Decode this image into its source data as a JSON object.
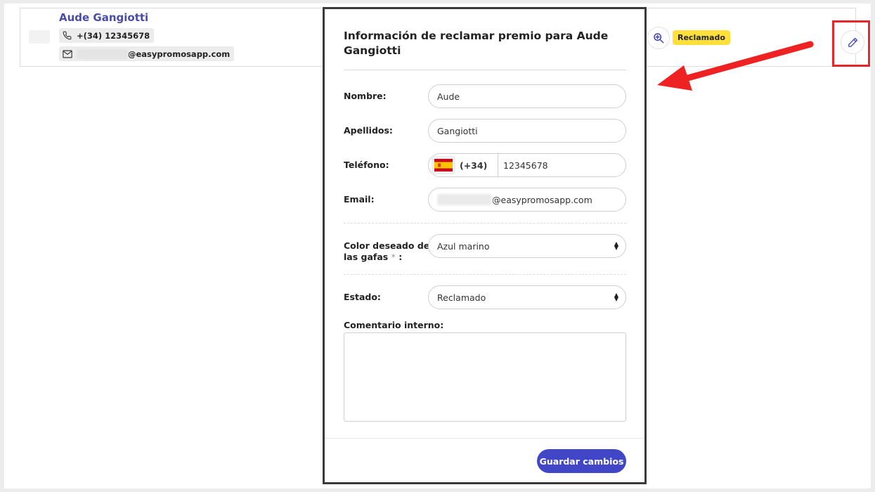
{
  "card": {
    "name": "Aude Gangiotti",
    "phone": "+(34) 12345678",
    "email_domain": "@easypromosapp.com",
    "status_badge": "Reclamado"
  },
  "modal": {
    "title": "Información de reclamar premio para Aude Gangiotti",
    "fields": {
      "nombre": {
        "label": "Nombre:",
        "value": "Aude"
      },
      "apellidos": {
        "label": "Apellidos:",
        "value": "Gangiotti"
      },
      "telefono": {
        "label": "Teléfono:",
        "code": "(+34)",
        "number": "12345678"
      },
      "email": {
        "label": "Email:",
        "value": "@easypromosapp.com"
      },
      "color": {
        "label_line1": "Color deseado de",
        "label_line2": "las gafas",
        "required_mark": "*",
        "colon": ":",
        "value": "Azul marino"
      },
      "estado": {
        "label": "Estado:",
        "value": "Reclamado"
      },
      "comentario": {
        "label": "Comentario interno:",
        "value": ""
      }
    },
    "save_label": "Guardar cambios"
  },
  "icons": {
    "phone": "phone-icon",
    "email": "mail-icon",
    "zoom": "zoom-in-icon",
    "edit": "pencil-icon",
    "flag": "spain-flag-icon"
  },
  "colors": {
    "accent": "#4146c6",
    "name_link": "#4a4ca8",
    "badge": "#ffe03a",
    "highlight": "#e8262b"
  }
}
